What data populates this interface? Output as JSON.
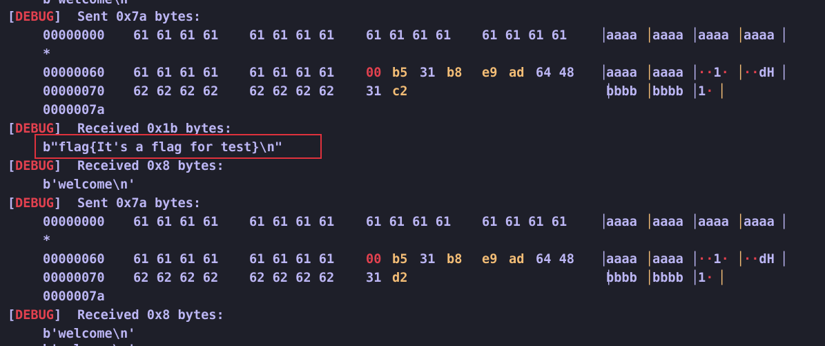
{
  "top_partial": "b'welcome\\n'",
  "blocks": [
    {
      "header": {
        "tag_open": "[",
        "tag": "DEBUG",
        "tag_close": "]",
        "text": "Sent 0x7a bytes:"
      },
      "rows": [
        {
          "offset": "00000000",
          "g1": "61 61 61 61",
          "g2": "61 61 61 61",
          "g3": "61 61 61 61",
          "g4": "61 61 61 61",
          "ascii": [
            "aaaa",
            "aaaa",
            "aaaa",
            "aaaa"
          ]
        },
        {
          "star": "*"
        },
        {
          "offset": "00000060",
          "g1": "61 61 61 61",
          "g2": "61 61 61 61",
          "g3a": "00",
          "g3b": "b5",
          "g3c": "31",
          "g3d": "b8",
          "g4a": "e9",
          "g4b": "ad",
          "g4c": "64 48",
          "ascii": [
            "aaaa",
            "aaaa",
            "··1·",
            "··dH"
          ]
        },
        {
          "offset": "00000070",
          "g1": "62 62 62 62",
          "g2": "62 62 62 62",
          "g3a": "31",
          "g3b": "c2",
          "ascii": [
            "bbbb",
            "bbbb",
            "1·"
          ]
        },
        {
          "offset": "0000007a"
        }
      ]
    },
    {
      "header": {
        "tag_open": "[",
        "tag": "DEBUG",
        "tag_close": "]",
        "text": "Received 0x1b bytes:"
      },
      "body": "b\"flag{It's a flag for test}\\n\""
    },
    {
      "header": {
        "tag_open": "[",
        "tag": "DEBUG",
        "tag_close": "]",
        "text": "Received 0x8 bytes:"
      },
      "body": "b'welcome\\n'"
    },
    {
      "header": {
        "tag_open": "[",
        "tag": "DEBUG",
        "tag_close": "]",
        "text": "Sent 0x7a bytes:"
      },
      "rows": [
        {
          "offset": "00000000",
          "g1": "61 61 61 61",
          "g2": "61 61 61 61",
          "g3": "61 61 61 61",
          "g4": "61 61 61 61",
          "ascii": [
            "aaaa",
            "aaaa",
            "aaaa",
            "aaaa"
          ]
        },
        {
          "star": "*"
        },
        {
          "offset": "00000060",
          "g1": "61 61 61 61",
          "g2": "61 61 61 61",
          "g3a": "00",
          "g3b": "b5",
          "g3c": "31",
          "g3d": "b8",
          "g4a": "e9",
          "g4b": "ad",
          "g4c": "64 48",
          "ascii": [
            "aaaa",
            "aaaa",
            "··1·",
            "··dH"
          ]
        },
        {
          "offset": "00000070",
          "g1": "62 62 62 62",
          "g2": "62 62 62 62",
          "g3a": "31",
          "g3b": "d2",
          "ascii": [
            "bbbb",
            "bbbb",
            "1·"
          ]
        },
        {
          "offset": "0000007a"
        }
      ]
    },
    {
      "header": {
        "tag_open": "[",
        "tag": "DEBUG",
        "tag_close": "]",
        "text": "Received 0x8 bytes:"
      },
      "body": "b'welcome\\n'"
    }
  ],
  "bottom_partial": "b'welcome\\n'",
  "colors": {
    "background": "#1e1f29",
    "text": "#bcb6f4",
    "debug": "#e3414f",
    "orange": "#f3bd76",
    "highlight": "#e0323d"
  }
}
